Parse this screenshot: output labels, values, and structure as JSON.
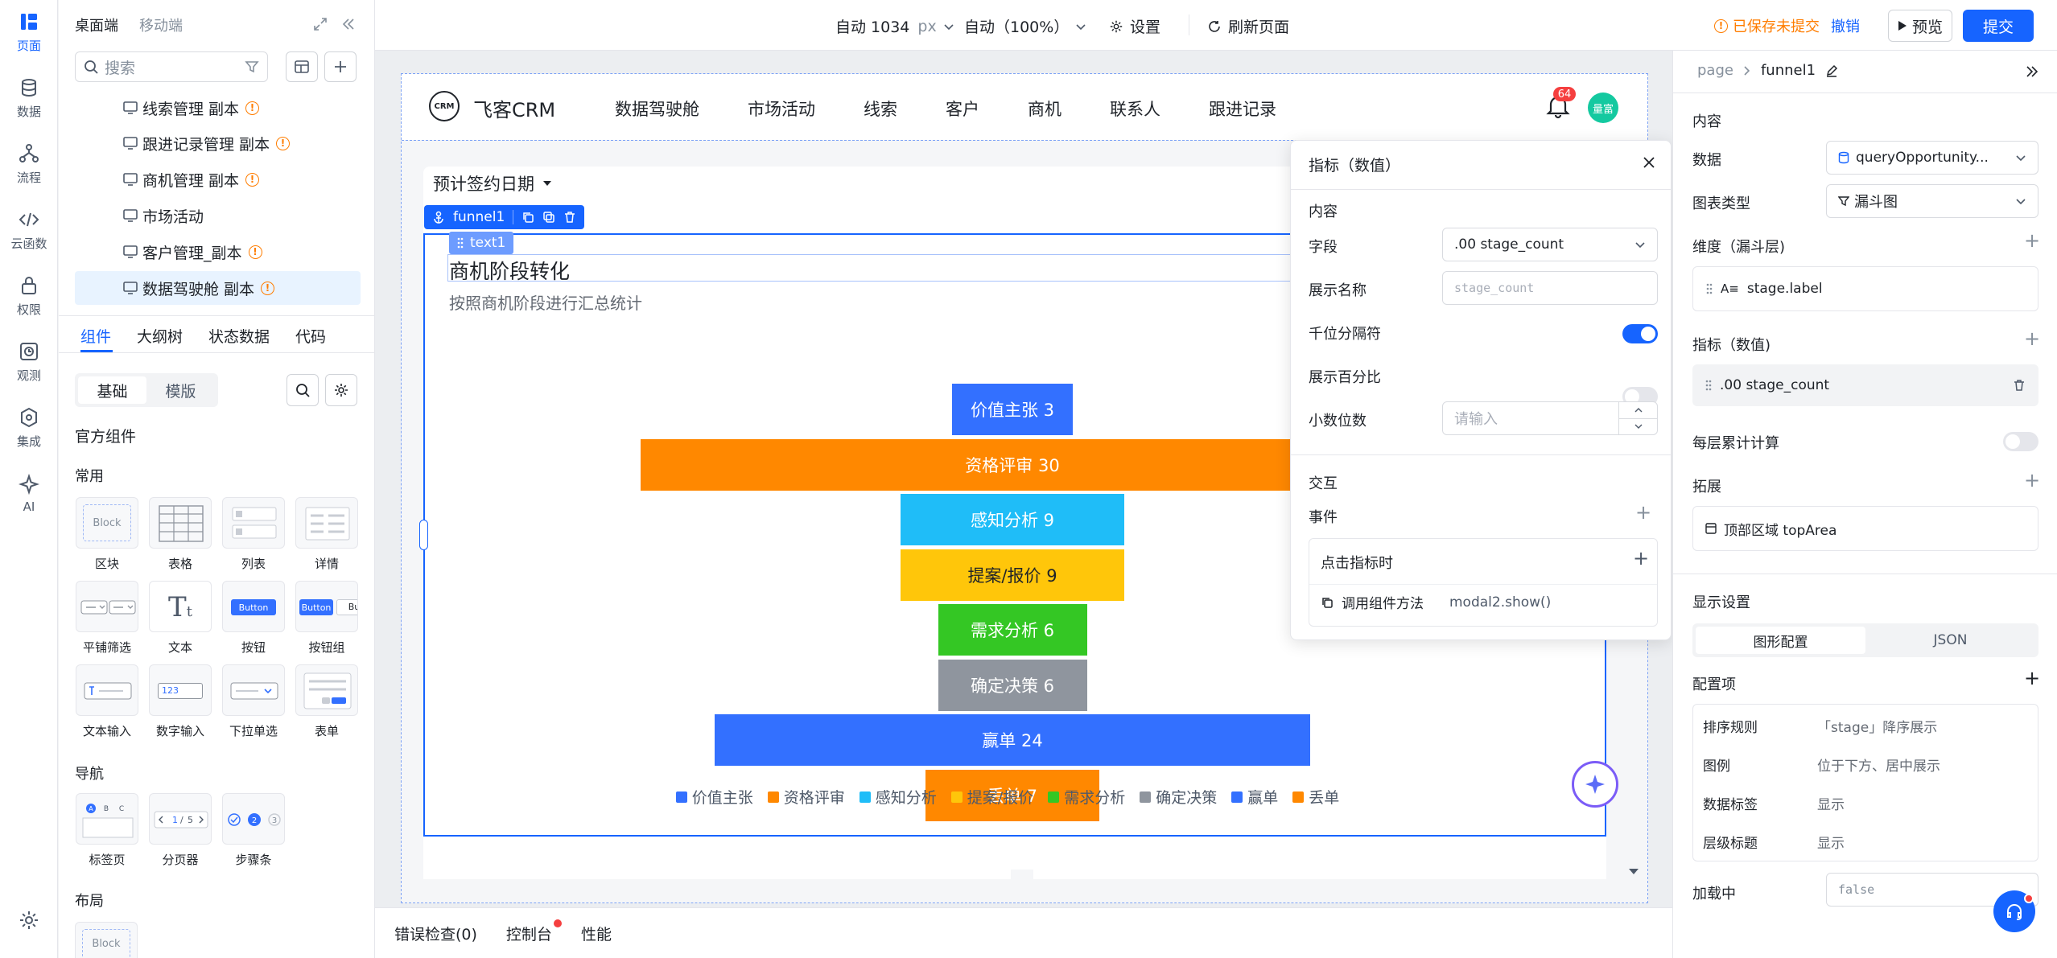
{
  "rail": [
    {
      "label": "页面",
      "icon": "page-icon",
      "active": true
    },
    {
      "label": "数据",
      "icon": "database-icon"
    },
    {
      "label": "流程",
      "icon": "flow-icon"
    },
    {
      "label": "云函数",
      "icon": "code-icon"
    },
    {
      "label": "权限",
      "icon": "lock-icon"
    },
    {
      "label": "观测",
      "icon": "monitor-icon"
    },
    {
      "label": "集成",
      "icon": "integration-icon"
    },
    {
      "label": "AI",
      "icon": "ai-sparkle-icon"
    }
  ],
  "left": {
    "tabs": [
      "桌面端",
      "移动端"
    ],
    "search_placeholder": "搜索",
    "tree": [
      "线索管理 副本",
      "跟进记录管理 副本",
      "商机管理 副本",
      "市场活动",
      "客户管理_副本",
      "数据驾驶舱 副本"
    ],
    "panel_tabs": [
      "组件",
      "大纲树",
      "状态数据",
      "代码"
    ],
    "seg": [
      "基础",
      "模版"
    ],
    "official": "官方组件",
    "common": "常用",
    "components_row1": [
      {
        "label": "区块",
        "thumb": "Block"
      },
      {
        "label": "表格"
      },
      {
        "label": "列表"
      },
      {
        "label": "详情"
      }
    ],
    "components_row2": [
      {
        "label": "平铺筛选"
      },
      {
        "label": "文本"
      },
      {
        "label": "按钮",
        "thumb": "Button"
      },
      {
        "label": "按钮组",
        "thumb": "Button"
      }
    ],
    "components_row3": [
      {
        "label": "文本输入"
      },
      {
        "label": "数字输入",
        "thumb": "123"
      },
      {
        "label": "下拉单选"
      },
      {
        "label": "表单"
      }
    ],
    "nav": "导航",
    "components_row4": [
      {
        "label": "标签页"
      },
      {
        "label": "分页器"
      },
      {
        "label": "步骤条"
      }
    ],
    "layout": "布局",
    "layout_thumb": "Block"
  },
  "topbar": {
    "width": "自动 1034",
    "width_unit": "px",
    "zoom": "自动（100%）",
    "settings": "设置",
    "refresh": "刷新页面",
    "unsaved": "已保存未提交",
    "undo": "撤销",
    "preview": "预览",
    "submit": "提交"
  },
  "app": {
    "logo_text": "CRM",
    "brand": "飞客CRM",
    "nav": [
      "数据驾驶舱",
      "市场活动",
      "线索",
      "客户",
      "商机",
      "联系人",
      "跟进记录"
    ],
    "badge": "64",
    "avatar": "量富"
  },
  "page": {
    "filter": "预计签约日期",
    "sel_tag": "funnel1",
    "text_tag": "text1",
    "chart_title": "商机阶段转化",
    "chart_subtitle": "按照商机阶段进行汇总统计"
  },
  "chart_data": {
    "type": "funnel",
    "categories": [
      "价值主张",
      "资格评审",
      "感知分析",
      "提案/报价",
      "需求分析",
      "确定决策",
      "赢单",
      "丢单"
    ],
    "values": [
      3,
      30,
      9,
      9,
      6,
      6,
      24,
      7
    ],
    "colors": [
      "#3370ff",
      "#ff8800",
      "#1fbdf8",
      "#ffc60a",
      "#34c724",
      "#8f959e",
      "#3370ff",
      "#ff8800"
    ],
    "legend_position": "bottom-center"
  },
  "popover": {
    "title": "指标（数值）",
    "section_content": "内容",
    "field_label": "字段",
    "field_value": ".00 stage_count",
    "display_name_label": "展示名称",
    "display_name_placeholder": "stage_count",
    "thousands_label": "千位分隔符",
    "thousands_on": true,
    "percent_label": "展示百分比",
    "percent_on": false,
    "decimals_label": "小数位数",
    "decimals_placeholder": "请输入",
    "section_interact": "交互",
    "events_label": "事件",
    "event_name": "点击指标时",
    "event_action": "调用组件方法",
    "event_target": "modal2.show()"
  },
  "right": {
    "breadcrumb_root": "page",
    "breadcrumb_current": "funnel1",
    "section_content": "内容",
    "data_label": "数据",
    "data_value": "queryOpportunity...",
    "chart_type_label": "图表类型",
    "chart_type_value": "漏斗图",
    "dimension_label": "维度（漏斗层)",
    "dimension_value": "stage.label",
    "metric_label": "指标（数值)",
    "metric_value": ".00 stage_count",
    "cumulative_label": "每层累计计算",
    "extend_label": "拓展",
    "extend_value": "顶部区域 topArea",
    "display_label": "显示设置",
    "seg": [
      "图形配置",
      "JSON"
    ],
    "config_label": "配置项",
    "config_rows": [
      {
        "k": "排序规则",
        "v": "「stage」降序展示"
      },
      {
        "k": "图例",
        "v": "位于下方、居中展示"
      },
      {
        "k": "数据标签",
        "v": "显示"
      },
      {
        "k": "层级标题",
        "v": "显示"
      }
    ],
    "loading_label": "加载中",
    "loading_value": "false"
  },
  "bottom": {
    "tabs": [
      "错误检查(0)",
      "控制台",
      "性能"
    ]
  }
}
